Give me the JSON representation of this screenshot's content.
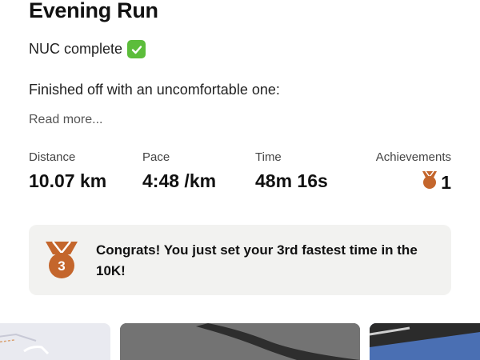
{
  "activity": {
    "title": "Evening Run",
    "subtitle": "NUC complete",
    "description": "Finished off with an uncomfortable one:",
    "read_more": "Read more..."
  },
  "stats": [
    {
      "label": "Distance",
      "value": "10.07 km"
    },
    {
      "label": "Pace",
      "value": "4:48 /km"
    },
    {
      "label": "Time",
      "value": "48m 16s"
    },
    {
      "label": "Achievements",
      "value": "1"
    }
  ],
  "achievement_card": {
    "medal_number": "3",
    "text": "Congrats! You just set your 3rd fastest time in the 10K!"
  },
  "colors": {
    "medal": "#c4662c",
    "check": "#5cbd3b",
    "card_bg": "#f2f2f0"
  },
  "icons": [
    "check-mark-icon",
    "medal-icon"
  ]
}
